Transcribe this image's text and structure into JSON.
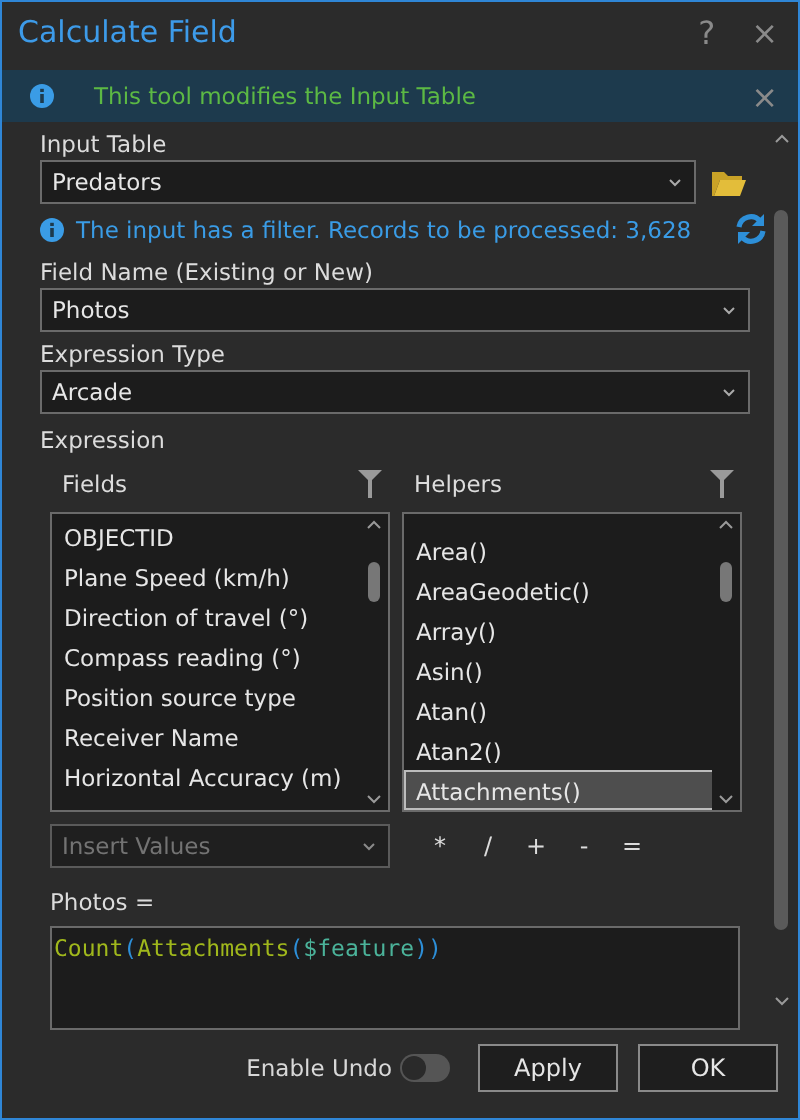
{
  "window": {
    "title": "Calculate Field",
    "help": "?",
    "close": "×"
  },
  "banner": {
    "text": "This tool modifies the Input Table",
    "close": "×"
  },
  "input_table": {
    "label": "Input Table",
    "value": "Predators"
  },
  "filter_note": "The input has a filter. Records to be processed: 3,628",
  "field_name": {
    "label": "Field Name (Existing or New)",
    "value": "Photos"
  },
  "expression_type": {
    "label": "Expression Type",
    "value": "Arcade"
  },
  "expression": {
    "label": "Expression",
    "fields": {
      "title": "Fields",
      "items": [
        {
          "label": "OBJECTID",
          "selected": false
        },
        {
          "label": "Plane Speed (km/h)",
          "selected": false
        },
        {
          "label": "Direction of travel (°)",
          "selected": false
        },
        {
          "label": "Compass reading (°)",
          "selected": false
        },
        {
          "label": "Position source type",
          "selected": false
        },
        {
          "label": "Receiver Name",
          "selected": false
        },
        {
          "label": "Horizontal Accuracy (m)",
          "selected": false
        }
      ]
    },
    "helpers": {
      "title": "Helpers",
      "items": [
        {
          "label": "Area()",
          "selected": false
        },
        {
          "label": "AreaGeodetic()",
          "selected": false
        },
        {
          "label": "Array()",
          "selected": false
        },
        {
          "label": "Asin()",
          "selected": false
        },
        {
          "label": "Atan()",
          "selected": false
        },
        {
          "label": "Atan2()",
          "selected": false
        },
        {
          "label": "Attachments()",
          "selected": true
        }
      ]
    },
    "insert_values": {
      "placeholder": "Insert Values",
      "disabled": true
    },
    "operators": [
      "*",
      "/",
      "+",
      "-",
      "="
    ],
    "target": "Photos =",
    "code": [
      {
        "text": "Count",
        "kind": "function"
      },
      {
        "text": "(",
        "kind": "paren"
      },
      {
        "text": "Attachments",
        "kind": "function"
      },
      {
        "text": "(",
        "kind": "paren"
      },
      {
        "text": "$feature",
        "kind": "variable"
      },
      {
        "text": "))",
        "kind": "paren"
      }
    ]
  },
  "footer": {
    "undo": {
      "label": "Enable Undo",
      "on": false
    },
    "buttons": [
      "Apply",
      "OK"
    ]
  }
}
